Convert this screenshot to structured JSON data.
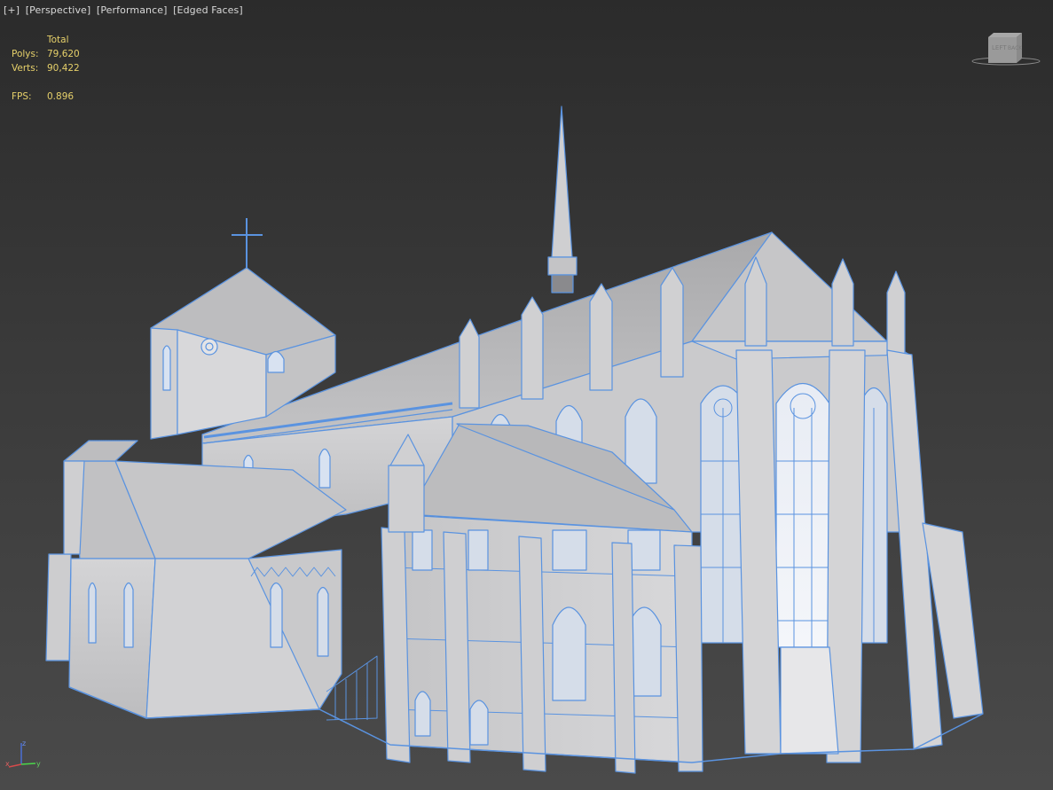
{
  "viewport": {
    "menu_plus": "[+]",
    "menu_view": "[Perspective]",
    "menu_shading_mode": "[Performance]",
    "menu_edged_faces": "[Edged Faces]"
  },
  "stats": {
    "header": "Total",
    "polys_label": "Polys:",
    "polys_value": "79,620",
    "verts_label": "Verts:",
    "verts_value": "90,422",
    "fps_label": "FPS:",
    "fps_value": "0.896"
  },
  "viewcube": {
    "left_face": "LEFT",
    "front_face": "BACK"
  },
  "axis_tripod": {
    "x": "x",
    "y": "y",
    "z": "z"
  },
  "model": {
    "description_icon": "cathedral-model",
    "wire_color": "#5a93e0",
    "surface_color": "#c9c9cb"
  }
}
